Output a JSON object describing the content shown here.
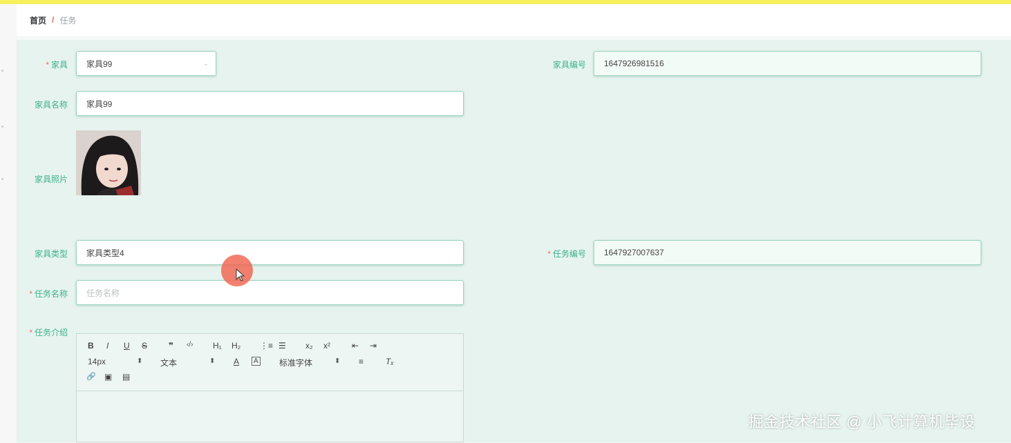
{
  "breadcrumb": {
    "home": "首页",
    "separator": "/",
    "current": "任务"
  },
  "form": {
    "furniture": {
      "label": "家具",
      "required": "*",
      "value": "家具99"
    },
    "furniture_no": {
      "label": "家具编号",
      "value": "1647926981516"
    },
    "furniture_name": {
      "label": "家具名称",
      "value": "家具99"
    },
    "furniture_photo": {
      "label": "家具照片"
    },
    "furniture_type": {
      "label": "家具类型",
      "value": "家具类型4"
    },
    "task_no": {
      "label": "任务编号",
      "required": "*",
      "value": "1647927007637"
    },
    "task_name": {
      "label": "任务名称",
      "required": "*",
      "value": "",
      "placeholder": "任务名称"
    },
    "task_intro": {
      "label": "任务介绍",
      "required": "*"
    }
  },
  "editor": {
    "toolbar": {
      "bold": "B",
      "italic": "I",
      "underline": "U",
      "strike": "S",
      "quote": "❞",
      "code": "‹/›",
      "h1": "H₁",
      "h2": "H₂",
      "ordered_list": "⋮≡",
      "bullet_list": "☰",
      "subscript": "x₂",
      "superscript": "x²",
      "indent_out": "⇤",
      "indent_in": "⇥",
      "font_size": "14px",
      "heading": "文本",
      "font_color": "A",
      "background": "A",
      "font_family": "标准字体",
      "align": "≡",
      "clear_format": "Tₓ",
      "link": "🔗",
      "image": "▣",
      "video": "▤"
    }
  },
  "watermark": "掘金技术社区 @ 小飞计算机毕设",
  "colors": {
    "label": "#3fb28e",
    "required": "#f56c6c",
    "panel": "#e6f3ee",
    "topbar": "#f7ef5c"
  }
}
